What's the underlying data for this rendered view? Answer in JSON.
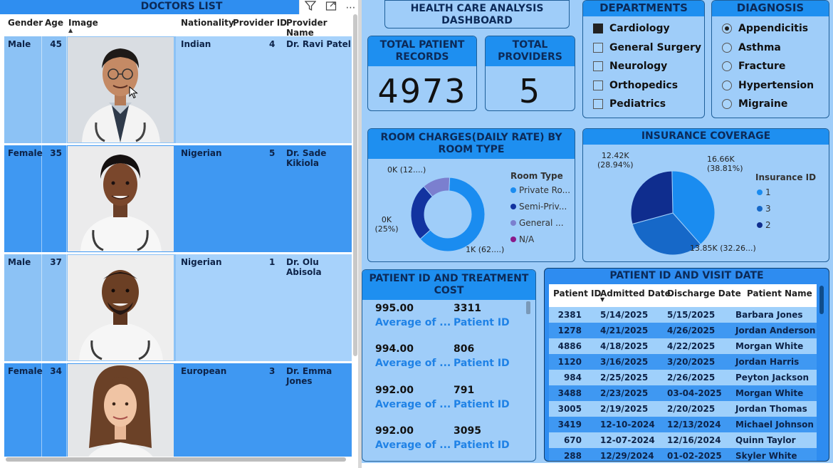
{
  "doctors": {
    "title": "DOCTORS LIST",
    "columns": {
      "gender": "Gender",
      "age": "Age",
      "image": "Image",
      "nationality": "Nationality",
      "provider_id": "Provider ID",
      "provider_name": "Provider Name"
    },
    "rows": [
      {
        "gender": "Male",
        "age": "45",
        "nationality": "Indian",
        "provider_id": "4",
        "provider_name": "Dr. Ravi Patel",
        "photo": "doctor-photo-male-glasses"
      },
      {
        "gender": "Female",
        "age": "35",
        "nationality": "Nigerian",
        "provider_id": "5",
        "provider_name": "Dr. Sade Kikiola",
        "photo": "doctor-photo-female"
      },
      {
        "gender": "Male",
        "age": "37",
        "nationality": "Nigerian",
        "provider_id": "1",
        "provider_name": "Dr. Olu Abisola",
        "photo": "doctor-photo-male-smiling"
      },
      {
        "gender": "Female",
        "age": "34",
        "nationality": "European",
        "provider_id": "3",
        "provider_name": "Dr. Emma Jones",
        "photo": "doctor-photo-female-brown-hair"
      }
    ]
  },
  "dashboard": {
    "title": "HEALTH CARE ANALYSIS DASHBOARD",
    "kpi": {
      "patient_records_label": "TOTAL PATIENT RECORDS",
      "patient_records_value": "4973",
      "providers_label": "TOTAL PROVIDERS",
      "providers_value": "5"
    },
    "departments": {
      "title": "DEPARTMENTS",
      "items": [
        {
          "label": "Cardiology",
          "checked": true
        },
        {
          "label": "General Surgery",
          "checked": false
        },
        {
          "label": "Neurology",
          "checked": false
        },
        {
          "label": "Orthopedics",
          "checked": false
        },
        {
          "label": "Pediatrics",
          "checked": false
        }
      ]
    },
    "diagnosis": {
      "title": "DIAGNOSIS",
      "items": [
        {
          "label": "Appendicitis",
          "selected": true
        },
        {
          "label": "Asthma",
          "selected": false
        },
        {
          "label": "Fracture",
          "selected": false
        },
        {
          "label": "Hypertension",
          "selected": false
        },
        {
          "label": "Migraine",
          "selected": false
        }
      ]
    },
    "room_chart_title": "ROOM CHARGES(DAILY RATE) BY ROOM TYPE",
    "insurance_chart_title": "INSURANCE COVERAGE",
    "cost_table": {
      "title": "PATIENT ID AND TREATMENT COST",
      "label_avg": "Average of ...",
      "label_pid": "Patient ID",
      "rows": [
        {
          "avg": "995.00",
          "pid": "3311"
        },
        {
          "avg": "994.00",
          "pid": "806"
        },
        {
          "avg": "992.00",
          "pid": "791"
        },
        {
          "avg": "992.00",
          "pid": "3095"
        }
      ]
    },
    "visit_table": {
      "title": "PATIENT ID AND VISIT DATE",
      "columns": {
        "pid": "Patient ID",
        "admitted": "Admitted Date",
        "discharge": "Discharge Date",
        "name": "Patient Name"
      },
      "rows": [
        {
          "pid": "2381",
          "admitted": "5/14/2025",
          "discharge": "5/15/2025",
          "name": "Barbara Jones"
        },
        {
          "pid": "1278",
          "admitted": "4/21/2025",
          "discharge": "4/26/2025",
          "name": "Jordan Anderson"
        },
        {
          "pid": "4886",
          "admitted": "4/18/2025",
          "discharge": "4/22/2025",
          "name": "Morgan White"
        },
        {
          "pid": "1120",
          "admitted": "3/16/2025",
          "discharge": "3/20/2025",
          "name": "Jordan Harris"
        },
        {
          "pid": "984",
          "admitted": "2/25/2025",
          "discharge": "2/26/2025",
          "name": "Peyton Jackson"
        },
        {
          "pid": "3488",
          "admitted": "2/23/2025",
          "discharge": "03-04-2025",
          "name": "Morgan White"
        },
        {
          "pid": "3005",
          "admitted": "2/19/2025",
          "discharge": "2/20/2025",
          "name": "Jordan Thomas"
        },
        {
          "pid": "3419",
          "admitted": "12-10-2024",
          "discharge": "12/13/2024",
          "name": "Michael Johnson"
        },
        {
          "pid": "670",
          "admitted": "12-07-2024",
          "discharge": "12/16/2024",
          "name": "Quinn Taylor"
        },
        {
          "pid": "288",
          "admitted": "12/29/2024",
          "discharge": "01-02-2025",
          "name": "Skyler White"
        }
      ]
    }
  },
  "chart_data": [
    {
      "type": "pie",
      "variant": "donut",
      "title": "ROOM CHARGES(DAILY RATE) BY ROOM TYPE",
      "legend_title": "Room Type",
      "legend_placement": "right",
      "categories": [
        "Private Ro...",
        "Semi-Priv...",
        "General ...",
        "N/A"
      ],
      "values": [
        62,
        25,
        12,
        0
      ],
      "colors": [
        "#1a8cf0",
        "#1233a0",
        "#7b7fcf",
        "#8a1a8a"
      ],
      "data_labels": [
        "1K (62....)",
        "0K (25%)",
        "0K (12....)",
        ""
      ]
    },
    {
      "type": "pie",
      "title": "INSURANCE COVERAGE",
      "legend_title": "Insurance ID",
      "legend_placement": "right",
      "categories": [
        "1",
        "3",
        "2"
      ],
      "values": [
        16.66,
        13.85,
        12.42
      ],
      "percents": [
        38.81,
        32.26,
        28.94
      ],
      "colors": [
        "#1a8cf0",
        "#1668c8",
        "#0f2d8e"
      ],
      "data_labels": [
        "16.66K (38.81%)",
        "13.85K (32.26...)",
        "12.42K (28.94%)"
      ]
    }
  ],
  "colors": {
    "accent": "#1e8ff0",
    "panel_bg": "#9fcdf9",
    "dark_text": "#0c2a58"
  },
  "icons": [
    "filter-icon",
    "focus-mode-icon",
    "more-options-icon"
  ]
}
